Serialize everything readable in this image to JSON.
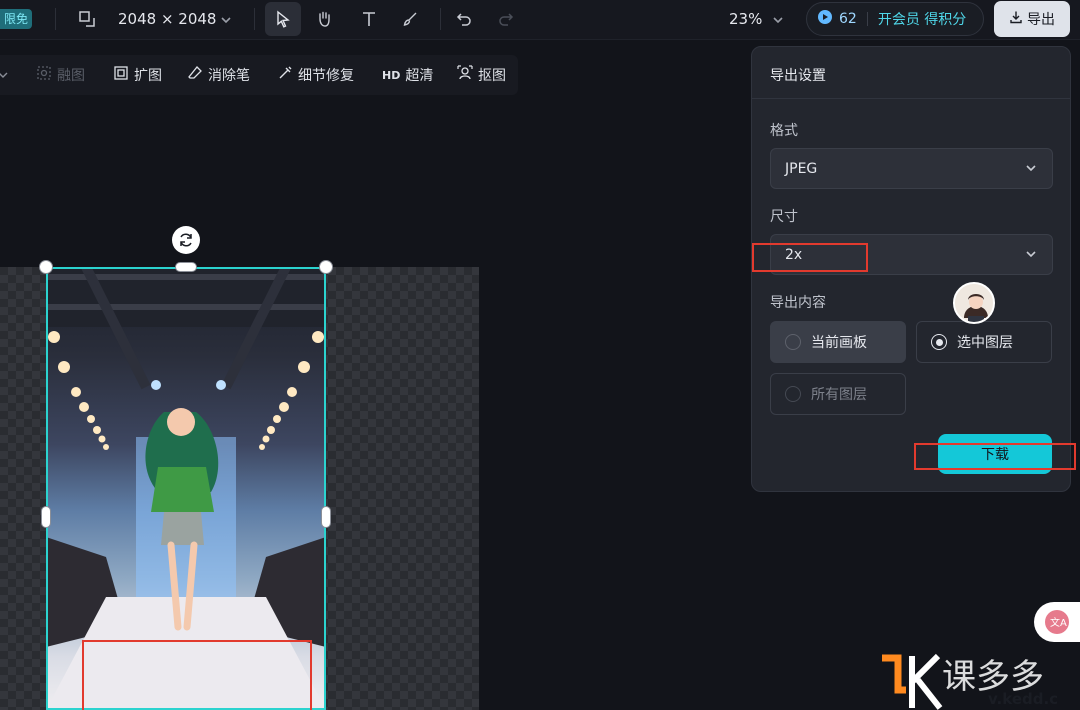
{
  "topbar": {
    "promo_badge": "限免",
    "canvas_size": "2048 × 2048",
    "zoom": "23%",
    "credits_count": "62",
    "vip_label": "开会员 得积分",
    "export_label": "导出"
  },
  "toolbar": {
    "items": [
      {
        "label": "融图",
        "icon": "blend-icon",
        "enabled": false
      },
      {
        "label": "扩图",
        "icon": "expand-icon",
        "enabled": true
      },
      {
        "label": "消除笔",
        "icon": "eraser-icon",
        "enabled": true
      },
      {
        "label": "细节修复",
        "icon": "repair-icon",
        "enabled": true
      },
      {
        "label": "超清",
        "icon_text": "HD",
        "enabled": true
      },
      {
        "label": "抠图",
        "icon": "cutout-icon",
        "enabled": true
      }
    ]
  },
  "export_panel": {
    "title": "导出设置",
    "format_label": "格式",
    "format_value": "JPEG",
    "size_label": "尺寸",
    "size_value": "2x",
    "content_label": "导出内容",
    "options": [
      {
        "label": "当前画板",
        "selected": false
      },
      {
        "label": "选中图层",
        "selected": true
      },
      {
        "label": "所有图层",
        "selected": false,
        "enabled": false
      }
    ],
    "download_label": "下载"
  },
  "watermark": {
    "text": "课多多",
    "url": "v.kedd.c"
  },
  "colors": {
    "accent": "#14c8d8",
    "selection": "#2bd3cf",
    "highlight_box": "#e23a2e"
  }
}
